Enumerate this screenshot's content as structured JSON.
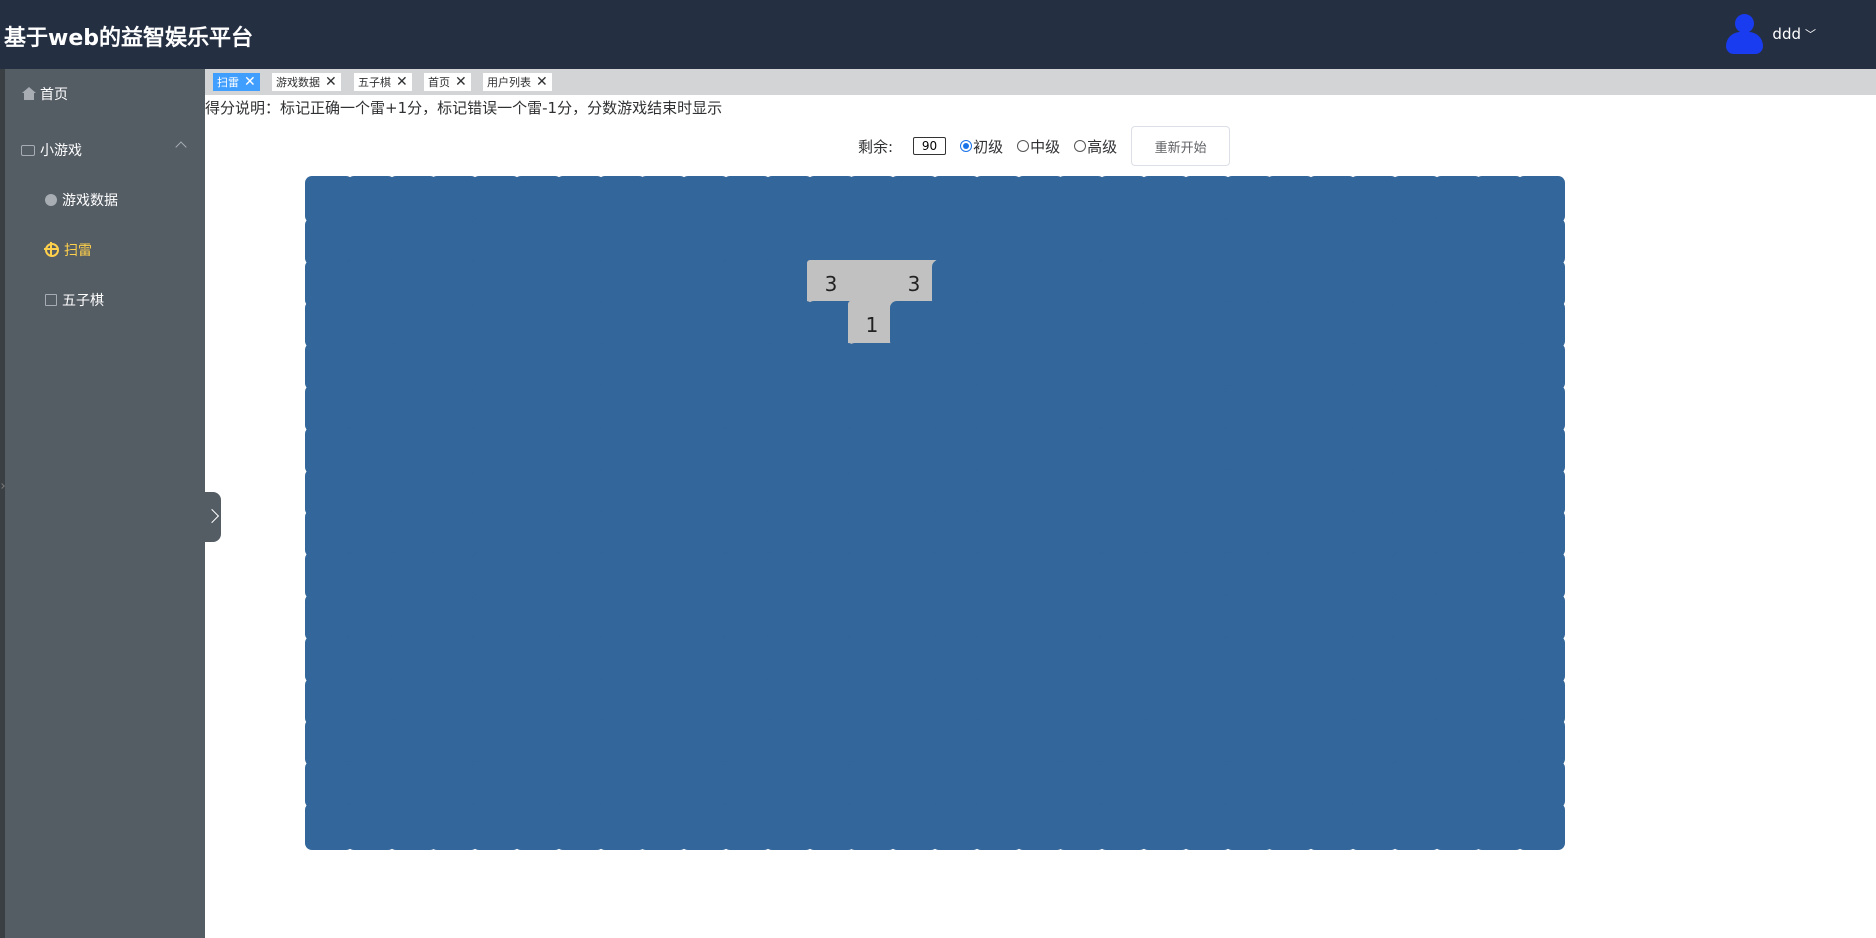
{
  "header": {
    "app_title": "基于web的益智娱乐平台",
    "username": "ddd",
    "user_chevron": "﹀"
  },
  "sidebar": {
    "items": [
      {
        "label": "首页",
        "icon": "home-icon"
      },
      {
        "label": "小游戏",
        "icon": "game-icon"
      },
      {
        "label": "游戏数据",
        "icon": "data-icon"
      },
      {
        "label": "扫雷",
        "icon": "minesweeper-icon",
        "active": true
      },
      {
        "label": "五子棋",
        "icon": "gomoku-icon"
      }
    ],
    "active_color": "#ffd04b"
  },
  "tabs": [
    {
      "label": "扫雷",
      "active": true
    },
    {
      "label": "游戏数据"
    },
    {
      "label": "五子棋"
    },
    {
      "label": "首页"
    },
    {
      "label": "用户列表"
    }
  ],
  "tab_close_glyph": "✕",
  "note": "得分说明：标记正确一个雷+1分，标记错误一个雷-1分，分数游戏结束时显示",
  "controls": {
    "remaining_label": "剩余:",
    "remaining_value": "90",
    "levels": [
      {
        "label": "初级",
        "checked": true
      },
      {
        "label": "中级",
        "checked": false
      },
      {
        "label": "高级",
        "checked": false
      }
    ],
    "restart_label": "重新开始"
  },
  "board": {
    "columns": 30,
    "visible_rows": 16,
    "cell_color": "#33669a",
    "open_color": "#c1c1c1",
    "open_cells": [
      {
        "row": 2,
        "col": 12,
        "value": "3"
      },
      {
        "row": 2,
        "col": 13,
        "value": ""
      },
      {
        "row": 2,
        "col": 14,
        "value": "3"
      },
      {
        "row": 3,
        "col": 13,
        "value": "1"
      }
    ]
  }
}
